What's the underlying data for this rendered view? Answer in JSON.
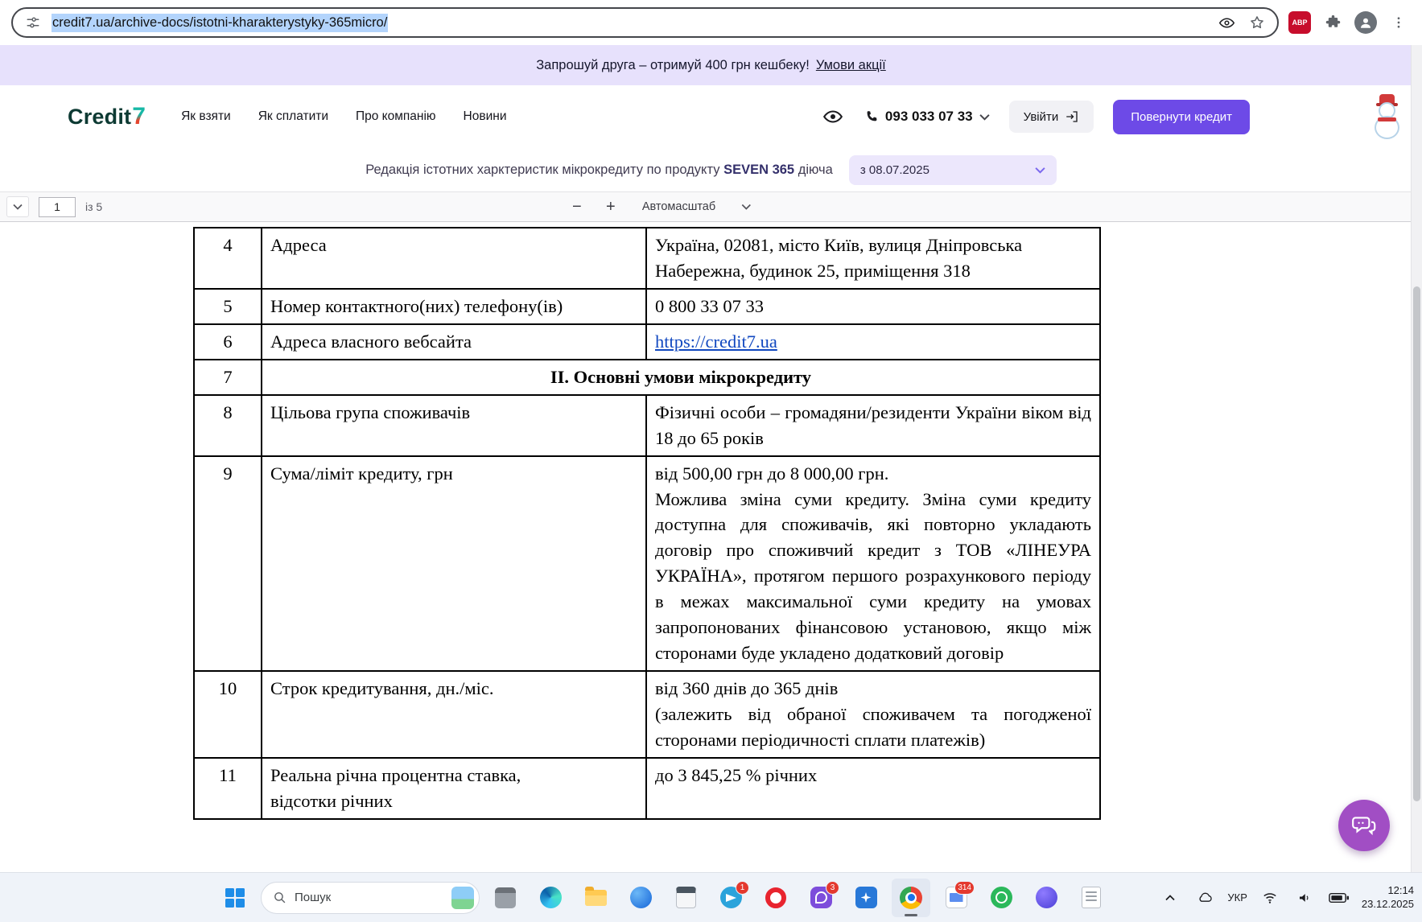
{
  "browser": {
    "url": "credit7.ua/archive-docs/istotni-kharakterystyky-365micro/",
    "adblock_label": "ABP"
  },
  "promo": {
    "text": "Запрошуй друга – отримуй 400 грн кешбеку!",
    "link_label": "Умови акції"
  },
  "header": {
    "logo_text": "Credit",
    "logo_digit": "7",
    "nav": [
      {
        "label": "Як взяти"
      },
      {
        "label": "Як сплатити"
      },
      {
        "label": "Про компанію"
      },
      {
        "label": "Новини"
      }
    ],
    "phone_number": "093 033 07 33",
    "login_label": "Увійти",
    "return_credit_label": "Повернути кредит"
  },
  "subheader": {
    "prefix": "Редакція істотних харктеристик мікрокредиту по продукту",
    "product": "SEVEN 365",
    "suffix": "діюча",
    "date_filter": "з 08.07.2025"
  },
  "pdf_toolbar": {
    "page_value": "1",
    "page_total": "із 5",
    "zoom_mode": "Автомасштаб"
  },
  "document": {
    "rows": [
      {
        "num": "4",
        "label": "Адреса",
        "value": "Україна, 02081, місто Київ, вулиця Дніпровська Набережна, будинок 25, приміщення 318"
      },
      {
        "num": "5",
        "label": "Номер контактного(них) телефону(ів)",
        "value": "0 800 33 07 33"
      },
      {
        "num": "6",
        "label": "Адреса власного вебсайта",
        "value": "https://credit7.ua"
      },
      {
        "num": "7",
        "section": "ІІ. Основні умови мікрокредиту"
      },
      {
        "num": "8",
        "label": "Цільова група споживачів",
        "value": "Фізичні особи – громадяни/резиденти України віком від 18 до 65 років"
      },
      {
        "num": "9",
        "label": "Сума/ліміт кредиту, грн",
        "value": "від 500,00 грн до 8 000,00 грн.\nМожлива зміна суми кредиту. Зміна суми кредиту доступна для споживачів, які повторно укладають договір про споживчий кредит з ТОВ «ЛІНЕУРА УКРАЇНА», протягом першого розрахункового періоду в межах максимальної суми кредиту на умовах запропонованих фінансовою установою, якщо між сторонами буде укладено додатковий договір"
      },
      {
        "num": "10",
        "label": "Строк кредитування, дн./міс.",
        "value": "від 360 днів до 365 днів\n(залежить від обраної споживачем та погодженої сторонами періодичності сплати платежів)"
      },
      {
        "num": "11",
        "label": "Реальна річна процентна ставка,\nвідсотки річних",
        "value": "до 3 845,25 % річних"
      }
    ]
  },
  "taskbar": {
    "search_label": "Пошук",
    "icons": [
      {
        "name": "app-window"
      },
      {
        "name": "edge"
      },
      {
        "name": "file-explorer"
      },
      {
        "name": "blue-app"
      },
      {
        "name": "calculator"
      },
      {
        "name": "telegram",
        "badge": "1"
      },
      {
        "name": "opera"
      },
      {
        "name": "viber",
        "badge": "3"
      },
      {
        "name": "photos"
      },
      {
        "name": "chrome",
        "active": true
      },
      {
        "name": "mail",
        "badge": "314"
      },
      {
        "name": "whatsapp"
      },
      {
        "name": "messenger"
      },
      {
        "name": "notes"
      }
    ],
    "tray": {
      "lang": "УКР",
      "time": "12:14",
      "date": "23.12.2025"
    }
  },
  "colors": {
    "accent_purple": "#6d4ae7",
    "banner_bg": "#e7e1fc",
    "url_selection": "#b3d4fc",
    "doc_link_blue": "#1148c0",
    "chat_bubble_purple": "#a14ec4",
    "badge_red": "#e4392e"
  }
}
